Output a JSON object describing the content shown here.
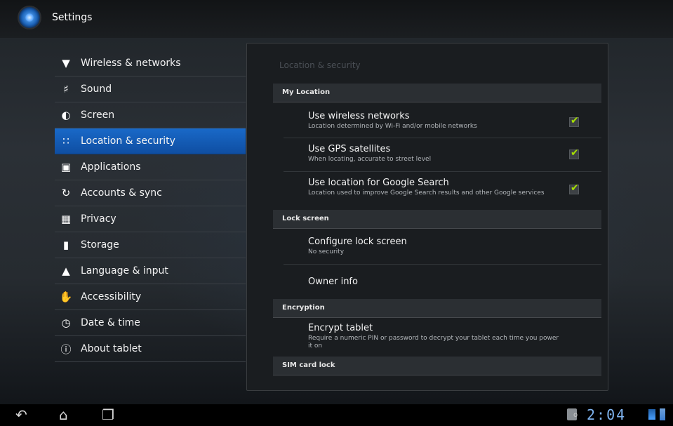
{
  "app": {
    "title": "Settings"
  },
  "nav": {
    "items": [
      {
        "label": "Wireless & networks",
        "icon": "wireless-icon"
      },
      {
        "label": "Sound",
        "icon": "sound-icon"
      },
      {
        "label": "Screen",
        "icon": "screen-icon"
      },
      {
        "label": "Location & security",
        "icon": "location-grid-icon",
        "selected": true
      },
      {
        "label": "Applications",
        "icon": "applications-icon"
      },
      {
        "label": "Accounts & sync",
        "icon": "sync-icon"
      },
      {
        "label": "Privacy",
        "icon": "privacy-icon"
      },
      {
        "label": "Storage",
        "icon": "storage-icon"
      },
      {
        "label": "Language & input",
        "icon": "language-icon"
      },
      {
        "label": "Accessibility",
        "icon": "accessibility-icon"
      },
      {
        "label": "Date & time",
        "icon": "clock-icon"
      },
      {
        "label": "About tablet",
        "icon": "info-icon"
      }
    ]
  },
  "panel": {
    "title": "Location & security",
    "sections": {
      "my_location": "My Location",
      "lock_screen": "Lock screen",
      "encryption": "Encryption",
      "sim_card_lock": "SIM card lock"
    },
    "prefs": {
      "wireless": {
        "title": "Use wireless networks",
        "summary": "Location determined by Wi-Fi and/or mobile networks",
        "checked": true
      },
      "gps": {
        "title": "Use GPS satellites",
        "summary": "When locating, accurate to street level",
        "checked": true
      },
      "google_search": {
        "title": "Use location for Google Search",
        "summary": "Location used to improve Google Search results and other Google services",
        "checked": true
      },
      "lock_screen": {
        "title": "Configure lock screen",
        "summary": "No security"
      },
      "owner_info": {
        "title": "Owner info"
      },
      "encrypt": {
        "title": "Encrypt tablet",
        "summary": "Require a numeric PIN or password to decrypt your tablet each time you power it on"
      }
    }
  },
  "system_bar": {
    "time": "2:04",
    "buttons": [
      "back-icon",
      "home-icon",
      "recent-apps-icon"
    ],
    "status_icons": [
      "sd-card-icon",
      "wifi-icon",
      "battery-icon"
    ]
  },
  "colors": {
    "accent": "#1969c8",
    "check": "#a6e000",
    "clock": "#7fb4f0"
  }
}
